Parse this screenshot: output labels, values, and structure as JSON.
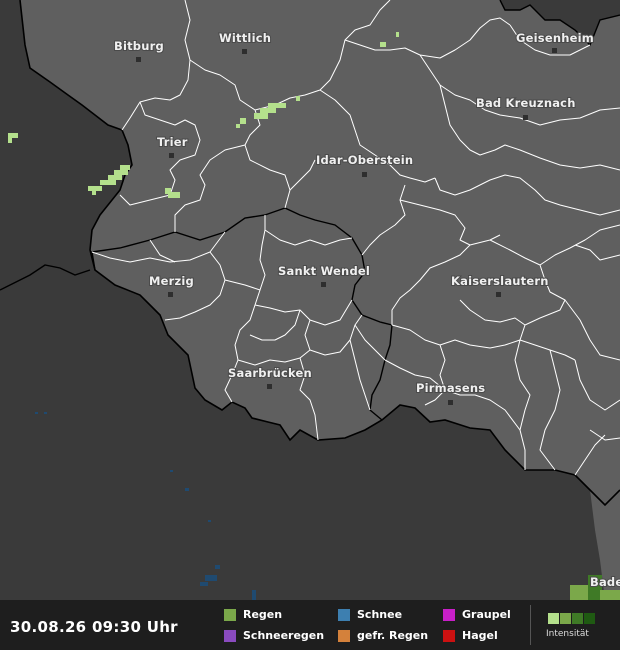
{
  "map": {
    "cities": [
      {
        "id": "bitburg",
        "name": "Bitburg"
      },
      {
        "id": "wittlich",
        "name": "Wittlich"
      },
      {
        "id": "geisenheim",
        "name": "Geisenheim"
      },
      {
        "id": "bad-kreuznach",
        "name": "Bad Kreuznach"
      },
      {
        "id": "trier",
        "name": "Trier"
      },
      {
        "id": "idar-oberstein",
        "name": "Idar-Oberstein"
      },
      {
        "id": "merzig",
        "name": "Merzig"
      },
      {
        "id": "sankt-wendel",
        "name": "Sankt Wendel"
      },
      {
        "id": "kaiserslautern",
        "name": "Kaiserslautern"
      },
      {
        "id": "saarbruecken",
        "name": "Saarbrücken"
      },
      {
        "id": "pirmasens",
        "name": "Pirmasens"
      },
      {
        "id": "bade",
        "name": "Bade"
      }
    ],
    "colors": {
      "land": "#5f5f5f",
      "outside": "#3a3a3a",
      "border": "#ffffff",
      "country_border": "#000000",
      "rain": "#b4e08c"
    }
  },
  "footer": {
    "timestamp": "30.08.26 09:30 Uhr",
    "legend": [
      {
        "label": "Regen",
        "color": "#7ba84a"
      },
      {
        "label": "Schnee",
        "color": "#3d7fb0"
      },
      {
        "label": "Graupel",
        "color": "#c81fc8"
      },
      {
        "label": "Schneeregen",
        "color": "#8a4bbf"
      },
      {
        "label": "gefr. Regen",
        "color": "#d4813b"
      },
      {
        "label": "Hagel",
        "color": "#cc1111"
      }
    ],
    "intensity_label": "Intensität",
    "intensity_colors": [
      "#b4e08c",
      "#7ba84a",
      "#3f7a26",
      "#1f5a12"
    ]
  }
}
